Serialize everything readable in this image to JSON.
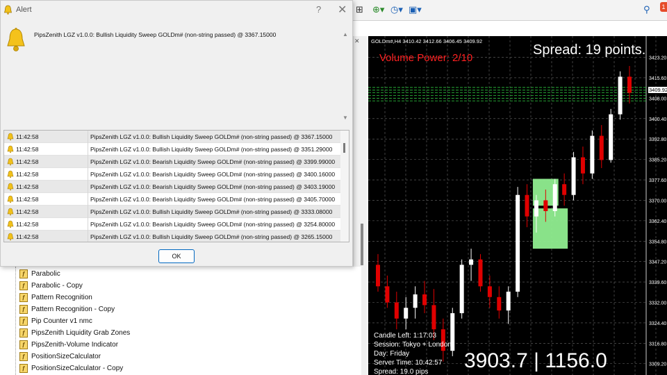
{
  "alert": {
    "title": "Alert",
    "help_label": "?",
    "close_label": "✕",
    "message": "PipsZenith LGZ v1.0.0: Bullish Liquidity Sweep GOLDm# (non-string passed) @ 3367.15000",
    "ok_label": "OK",
    "rows": [
      {
        "time": "11:42:58",
        "message": "PipsZenith LGZ v1.0.0: Bullish Liquidity Sweep GOLDm# (non-string passed) @ 3367.15000"
      },
      {
        "time": "11:42:58",
        "message": "PipsZenith LGZ v1.0.0: Bullish Liquidity Sweep GOLDm# (non-string passed) @ 3351.29000"
      },
      {
        "time": "11:42:58",
        "message": "PipsZenith LGZ v1.0.0: Bearish Liquidity Sweep GOLDm# (non-string passed) @ 3399.99000"
      },
      {
        "time": "11:42:58",
        "message": "PipsZenith LGZ v1.0.0: Bearish Liquidity Sweep GOLDm# (non-string passed) @ 3400.16000"
      },
      {
        "time": "11:42:58",
        "message": "PipsZenith LGZ v1.0.0: Bearish Liquidity Sweep GOLDm# (non-string passed) @ 3403.19000"
      },
      {
        "time": "11:42:58",
        "message": "PipsZenith LGZ v1.0.0: Bearish Liquidity Sweep GOLDm# (non-string passed) @ 3405.70000"
      },
      {
        "time": "11:42:58",
        "message": "PipsZenith LGZ v1.0.0: Bullish Liquidity Sweep GOLDm# (non-string passed) @ 3333.08000"
      },
      {
        "time": "11:42:58",
        "message": "PipsZenith LGZ v1.0.0: Bearish Liquidity Sweep GOLDm# (non-string passed) @ 3254.80000"
      },
      {
        "time": "11:42:58",
        "message": "PipsZenith LGZ v1.0.0: Bullish Liquidity Sweep GOLDm# (non-string passed) @ 3265.15000"
      }
    ]
  },
  "navigator": {
    "items": [
      {
        "label": "Parabolic"
      },
      {
        "label": "Parabolic - Copy"
      },
      {
        "label": "Pattern Recognition"
      },
      {
        "label": "Pattern Recognition - Copy"
      },
      {
        "label": "Pip Counter v1 nmc"
      },
      {
        "label": "PipsZenith Liquidity Grab Zones"
      },
      {
        "label": "PipsZenith-Volume Indicator"
      },
      {
        "label": "PositionSizeCalculator"
      },
      {
        "label": "PositionSizeCalculator - Copy"
      }
    ]
  },
  "toolbar": {
    "new_chart_icon": "add-chart-icon",
    "clock_icon": "clock-icon",
    "template_icon": "template-icon"
  },
  "chart": {
    "symbol_header": "GOLDm#,H4  3410.42 3412.66 3406.45 3409.92",
    "volume_power": "Volume Power: 2/10",
    "spread_big": "Spread: 19 points.",
    "current_price_label": "3409.92",
    "candle_left": "Candle Left: 1:17:03",
    "session": "Session: Tokyo + London",
    "day": "Day: Friday",
    "server_time": "Server Time: 10:42:57",
    "spread_small": "Spread: 19.0 pips",
    "big_readout": "3903.7 | 1156.0",
    "colors": {
      "bull": "#ffffff",
      "bear": "#e00000",
      "zone": "#90ee90",
      "volume_text": "#ff2020",
      "level": "#2ecc40"
    },
    "price_axis": [
      "3423.20",
      "3415.60",
      "3408.00",
      "3400.40",
      "3392.80",
      "3385.20",
      "3377.60",
      "3370.00",
      "3362.40",
      "3354.80",
      "3347.20",
      "3339.60",
      "3332.00",
      "3324.40",
      "3316.80",
      "3309.20"
    ]
  },
  "chart_data": {
    "type": "candlestick",
    "symbol": "GOLDm#",
    "timeframe": "H4",
    "ylim": [
      3305,
      3428
    ],
    "candles": [
      {
        "o": 3346,
        "h": 3350,
        "l": 3336,
        "c": 3338
      },
      {
        "o": 3338,
        "h": 3342,
        "l": 3330,
        "c": 3332
      },
      {
        "o": 3332,
        "h": 3336,
        "l": 3322,
        "c": 3326
      },
      {
        "o": 3326,
        "h": 3334,
        "l": 3322,
        "c": 3330
      },
      {
        "o": 3330,
        "h": 3338,
        "l": 3326,
        "c": 3335
      },
      {
        "o": 3335,
        "h": 3340,
        "l": 3328,
        "c": 3331
      },
      {
        "o": 3331,
        "h": 3337,
        "l": 3318,
        "c": 3322
      },
      {
        "o": 3322,
        "h": 3326,
        "l": 3310,
        "c": 3314
      },
      {
        "o": 3314,
        "h": 3330,
        "l": 3312,
        "c": 3328
      },
      {
        "o": 3328,
        "h": 3348,
        "l": 3326,
        "c": 3346
      },
      {
        "o": 3346,
        "h": 3352,
        "l": 3340,
        "c": 3348
      },
      {
        "o": 3348,
        "h": 3350,
        "l": 3336,
        "c": 3338
      },
      {
        "o": 3338,
        "h": 3342,
        "l": 3330,
        "c": 3334
      },
      {
        "o": 3334,
        "h": 3338,
        "l": 3326,
        "c": 3329
      },
      {
        "o": 3329,
        "h": 3338,
        "l": 3324,
        "c": 3336
      },
      {
        "o": 3336,
        "h": 3375,
        "l": 3334,
        "c": 3372
      },
      {
        "o": 3372,
        "h": 3376,
        "l": 3360,
        "c": 3364
      },
      {
        "o": 3364,
        "h": 3372,
        "l": 3358,
        "c": 3370
      },
      {
        "o": 3370,
        "h": 3374,
        "l": 3362,
        "c": 3366
      },
      {
        "o": 3366,
        "h": 3378,
        "l": 3364,
        "c": 3376
      },
      {
        "o": 3376,
        "h": 3380,
        "l": 3368,
        "c": 3372
      },
      {
        "o": 3372,
        "h": 3388,
        "l": 3370,
        "c": 3386
      },
      {
        "o": 3386,
        "h": 3390,
        "l": 3376,
        "c": 3380
      },
      {
        "o": 3380,
        "h": 3396,
        "l": 3378,
        "c": 3394
      },
      {
        "o": 3394,
        "h": 3398,
        "l": 3382,
        "c": 3385
      },
      {
        "o": 3385,
        "h": 3404,
        "l": 3384,
        "c": 3402
      },
      {
        "o": 3402,
        "h": 3418,
        "l": 3400,
        "c": 3416
      },
      {
        "o": 3416,
        "h": 3420,
        "l": 3406,
        "c": 3410
      }
    ],
    "levels": [
      3412,
      3411,
      3410,
      3409,
      3408,
      3407
    ],
    "zones": [
      {
        "from": 3368,
        "to": 3378,
        "x_from": 17,
        "x_to": 19
      },
      {
        "from": 3352,
        "to": 3367,
        "x_from": 17,
        "x_to": 20
      }
    ]
  }
}
